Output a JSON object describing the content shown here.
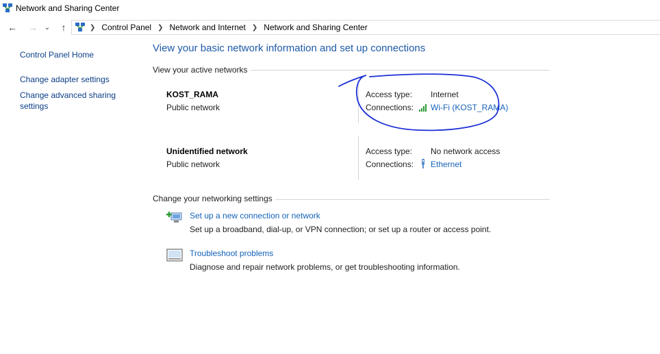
{
  "window": {
    "title": "Network and Sharing Center"
  },
  "address_bar": {
    "breadcrumbs": [
      "Control Panel",
      "Network and Internet",
      "Network and Sharing Center"
    ]
  },
  "sidebar": {
    "links": [
      "Control Panel Home",
      "Change adapter settings",
      "Change advanced sharing settings"
    ]
  },
  "main": {
    "title": "View your basic network information and set up connections",
    "active_networks_header": "View your active networks",
    "access_type_label": "Access type:",
    "connections_label": "Connections:",
    "networks": [
      {
        "name": "KOST_RAMA",
        "type": "Public network",
        "access": "Internet",
        "connection": "Wi-Fi (KOST_RAMA)",
        "connection_icon": "wifi-signal-icon"
      },
      {
        "name": "Unidentified network",
        "type": "Public network",
        "access": "No network access",
        "connection": "Ethernet",
        "connection_icon": "ethernet-icon"
      }
    ],
    "settings_header": "Change your networking settings",
    "tasks": [
      {
        "link": "Set up a new connection or network",
        "description": "Set up a broadband, dial-up, or VPN connection; or set up a router or access point.",
        "icon": "new-connection-icon"
      },
      {
        "link": "Troubleshoot problems",
        "description": "Diagnose and repair network problems, or get troubleshooting information.",
        "icon": "troubleshoot-icon"
      }
    ]
  },
  "colors": {
    "link": "#1462b8",
    "title": "#1e5aa8",
    "annotation_ink": "#1a2fd6"
  }
}
